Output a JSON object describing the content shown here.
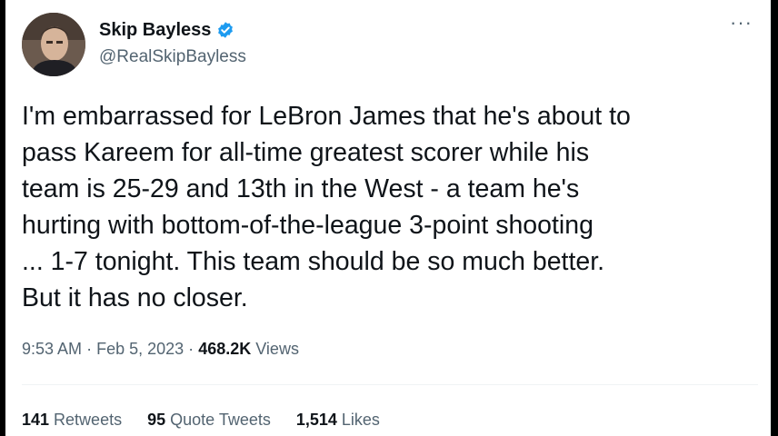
{
  "author": {
    "name": "Skip Bayless",
    "handle": "@RealSkipBayless",
    "verified_color": "#1d9bf0"
  },
  "tweet": {
    "text": "I'm embarrassed for LeBron James that he's about to\npass Kareem for all-time greatest scorer while his\nteam is 25-29 and 13th in the West - a team he's\nhurting with bottom-of-the-league 3-point shooting\n... 1-7 tonight. This team should be so much better.\nBut it has no closer.",
    "time": "9:53 AM",
    "sep1": "·",
    "date": "Feb 5, 2023",
    "sep2": "·",
    "views_count": "468.2K",
    "views_label": "Views"
  },
  "stats": {
    "retweets_count": "141",
    "retweets_label": "Retweets",
    "quotes_count": "95",
    "quotes_label": "Quote Tweets",
    "likes_count": "1,514",
    "likes_label": "Likes"
  },
  "icons": {
    "more": "more-horizontal-icon",
    "verified": "verified-badge-icon"
  }
}
